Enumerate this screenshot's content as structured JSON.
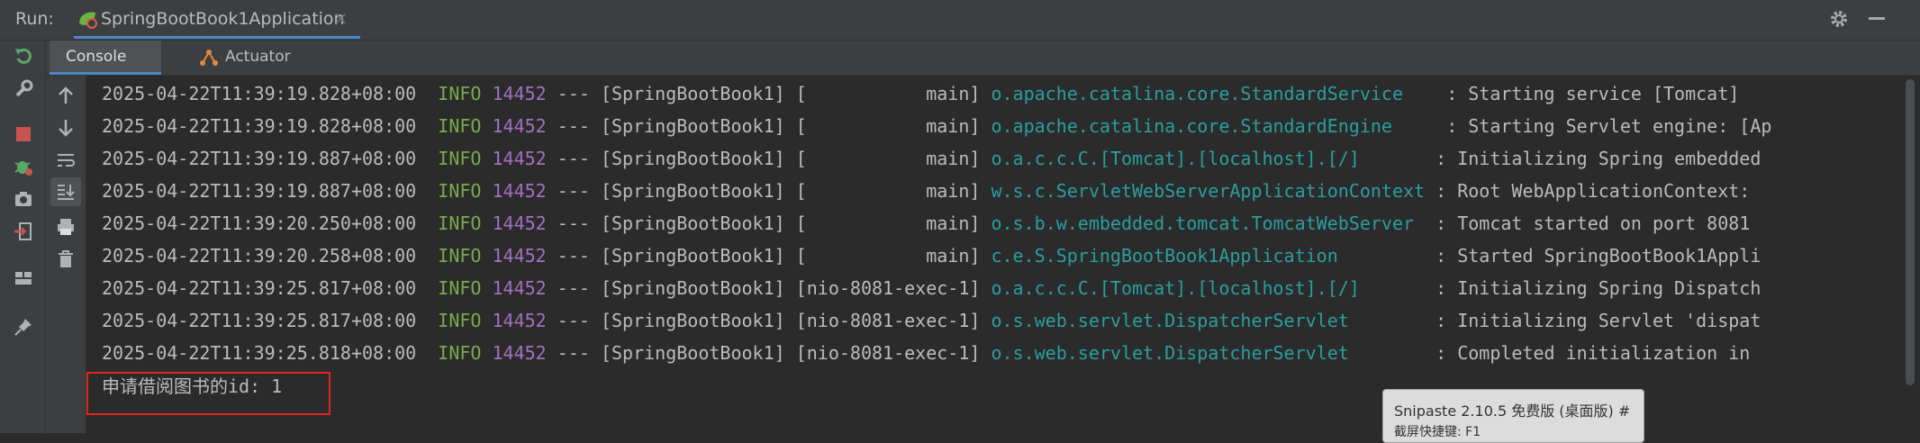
{
  "run_bar": {
    "label": "Run:",
    "tab_title": "SpringBootBook1Application",
    "close": "×"
  },
  "tabs": [
    {
      "label": "Console",
      "active": true
    },
    {
      "label": "Actuator",
      "active": false
    }
  ],
  "left_toolbar_icons": [
    "rerun-icon",
    "wrench-icon",
    "stop-icon",
    "debug-bug-icon",
    "camera-icon",
    "exit-icon",
    "layout-icon",
    "pin-icon"
  ],
  "console_toolbar_icons": [
    "arrow-up-icon",
    "arrow-down-icon",
    "soft-wrap-icon",
    "scroll-to-end-icon",
    "print-icon",
    "trash-icon"
  ],
  "log_lines": [
    {
      "ts": "2025-04-22T11:39:19.828+08:00",
      "level": "INFO",
      "pid": "14452",
      "sep": "---",
      "app": "[SpringBootBook1]",
      "thread": "[           main]",
      "logger": "o.apache.catalina.core.StandardService   ",
      "msg": ": Starting service [Tomcat]"
    },
    {
      "ts": "2025-04-22T11:39:19.828+08:00",
      "level": "INFO",
      "pid": "14452",
      "sep": "---",
      "app": "[SpringBootBook1]",
      "thread": "[           main]",
      "logger": "o.apache.catalina.core.StandardEngine    ",
      "msg": ": Starting Servlet engine: [Ap"
    },
    {
      "ts": "2025-04-22T11:39:19.887+08:00",
      "level": "INFO",
      "pid": "14452",
      "sep": "---",
      "app": "[SpringBootBook1]",
      "thread": "[           main]",
      "logger": "o.a.c.c.C.[Tomcat].[localhost].[/]      ",
      "msg": ": Initializing Spring embedded"
    },
    {
      "ts": "2025-04-22T11:39:19.887+08:00",
      "level": "INFO",
      "pid": "14452",
      "sep": "---",
      "app": "[SpringBootBook1]",
      "thread": "[           main]",
      "logger": "w.s.c.ServletWebServerApplicationContext",
      "msg": ": Root WebApplicationContext:"
    },
    {
      "ts": "2025-04-22T11:39:20.250+08:00",
      "level": "INFO",
      "pid": "14452",
      "sep": "---",
      "app": "[SpringBootBook1]",
      "thread": "[           main]",
      "logger": "o.s.b.w.embedded.tomcat.TomcatWebServer ",
      "msg": ": Tomcat started on port 8081"
    },
    {
      "ts": "2025-04-22T11:39:20.258+08:00",
      "level": "INFO",
      "pid": "14452",
      "sep": "---",
      "app": "[SpringBootBook1]",
      "thread": "[           main]",
      "logger": "c.e.S.SpringBootBook1Application        ",
      "msg": ": Started SpringBootBook1Appli"
    },
    {
      "ts": "2025-04-22T11:39:25.817+08:00",
      "level": "INFO",
      "pid": "14452",
      "sep": "---",
      "app": "[SpringBootBook1]",
      "thread": "[nio-8081-exec-1]",
      "logger": "o.a.c.c.C.[Tomcat].[localhost].[/]      ",
      "msg": ": Initializing Spring Dispatch"
    },
    {
      "ts": "2025-04-22T11:39:25.817+08:00",
      "level": "INFO",
      "pid": "14452",
      "sep": "---",
      "app": "[SpringBootBook1]",
      "thread": "[nio-8081-exec-1]",
      "logger": "o.s.web.servlet.DispatcherServlet       ",
      "msg": ": Initializing Servlet 'dispat"
    },
    {
      "ts": "2025-04-22T11:39:25.818+08:00",
      "level": "INFO",
      "pid": "14452",
      "sep": "---",
      "app": "[SpringBootBook1]",
      "thread": "[nio-8081-exec-1]",
      "logger": "o.s.web.servlet.DispatcherServlet       ",
      "msg": ": Completed initialization in"
    }
  ],
  "output_line": "申请借阅图书的id: 1",
  "tooltip": {
    "line1": "Snipaste 2.10.5 免费版 (桌面版) #",
    "line2": "截屏快捷键: F1"
  },
  "colors": {
    "info": "#7ba94d",
    "pid": "#a46fc2",
    "logger": "#2a9ea0",
    "highlight": "#e0241c",
    "accent": "#4a88c7"
  }
}
